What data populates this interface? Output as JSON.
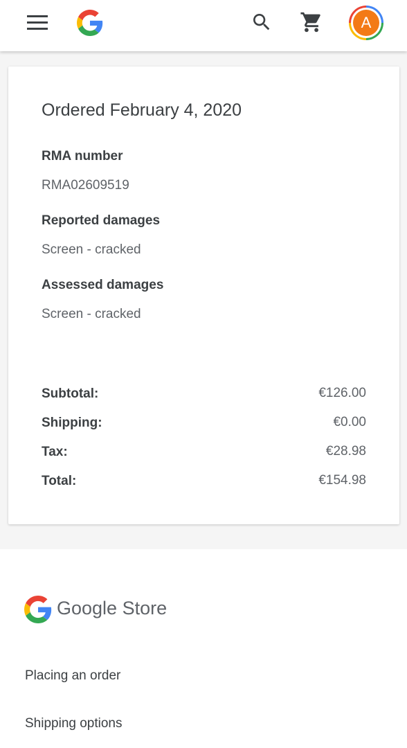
{
  "appbar": {
    "avatar_initial": "A"
  },
  "order": {
    "title": "Ordered February 4, 2020",
    "rma_label": "RMA number",
    "rma_value": "RMA02609519",
    "reported_label": "Reported damages",
    "reported_value": "Screen - cracked",
    "assessed_label": "Assessed damages",
    "assessed_value": "Screen - cracked"
  },
  "summary": {
    "subtotal_label": "Subtotal:",
    "subtotal_value": "€126.00",
    "shipping_label": "Shipping:",
    "shipping_value": "€0.00",
    "tax_label": "Tax:",
    "tax_value": "€28.98",
    "total_label": "Total:",
    "total_value": "€154.98"
  },
  "footer": {
    "store_name": "Google Store",
    "links": [
      "Placing an order",
      "Shipping options"
    ]
  },
  "colors": {
    "google_blue": "#4285F4",
    "google_red": "#EA4335",
    "google_yellow": "#FBBC05",
    "google_green": "#34A853",
    "avatar": "#f37a16"
  },
  "icons": [
    "menu-icon",
    "google-logo-icon",
    "search-icon",
    "cart-icon",
    "avatar"
  ]
}
